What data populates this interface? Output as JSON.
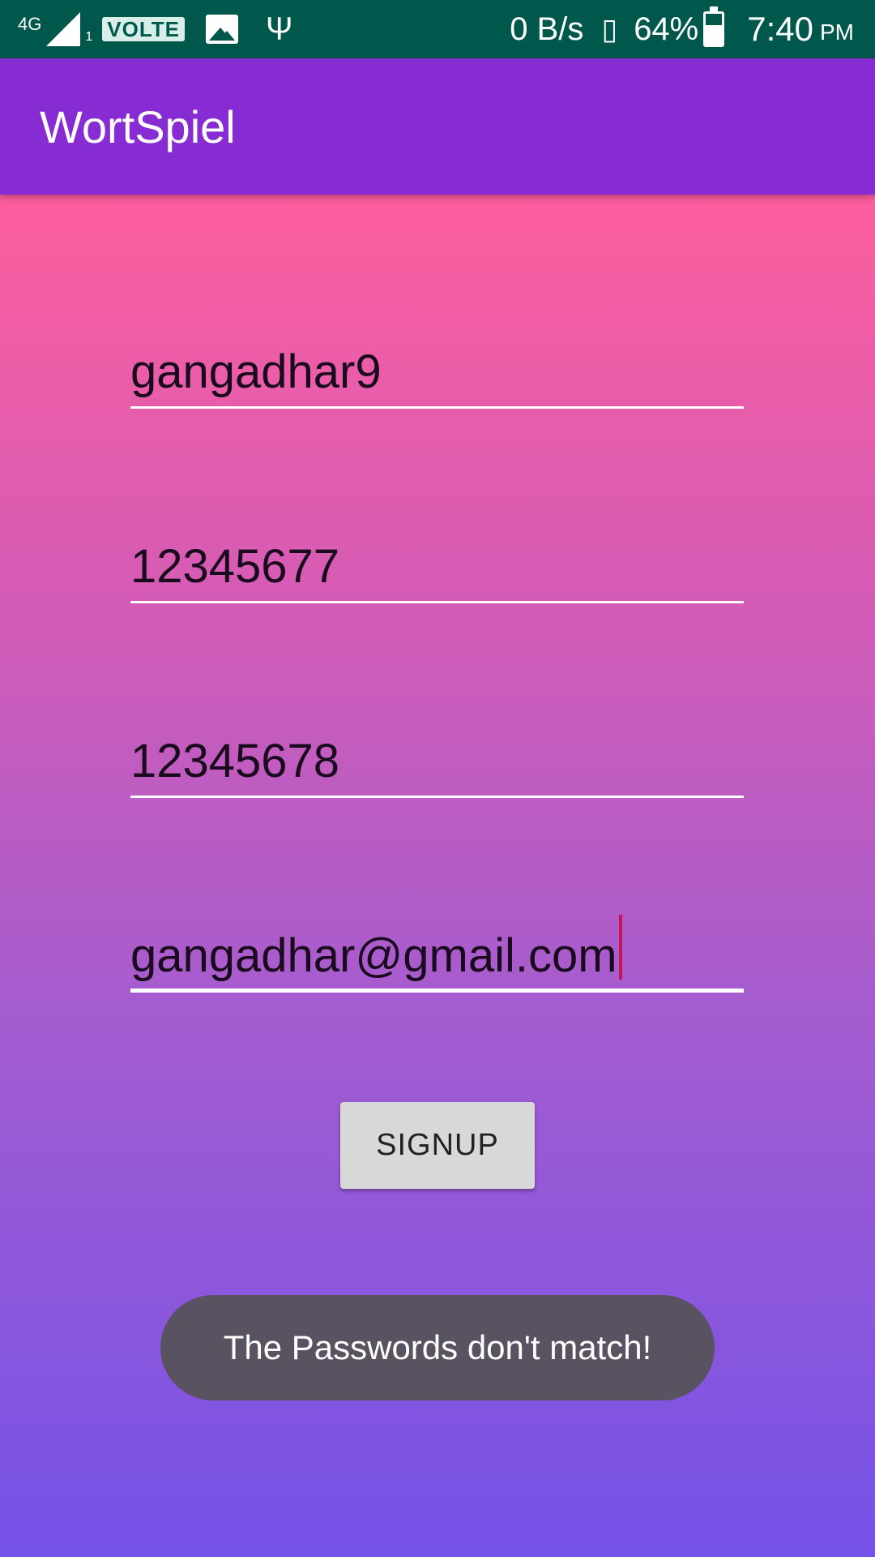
{
  "status_bar": {
    "network_type": "4G",
    "sim_number": "1",
    "volte": "VOLTE",
    "net_speed": "0 B/s",
    "battery": "64%",
    "time": "7:40",
    "ampm": "PM",
    "icons": [
      "signal-icon",
      "image-icon",
      "usb-icon",
      "vibrate-icon",
      "battery-charging-icon"
    ]
  },
  "app_bar": {
    "title": "WortSpiel"
  },
  "form": {
    "username": "gangadhar9",
    "password": "12345677",
    "confirm_password": "12345678",
    "email": "gangadhar@gmail.com",
    "signup_label": "SIGNUP"
  },
  "toast": {
    "message": "The Passwords don't match!"
  },
  "colors": {
    "status_bar": "#00574b",
    "app_bar": "#862cd2",
    "gradient_top": "#fd5e9e",
    "gradient_bottom": "#7552e8",
    "cursor": "#c2185b",
    "toast_bg": "#595361"
  }
}
